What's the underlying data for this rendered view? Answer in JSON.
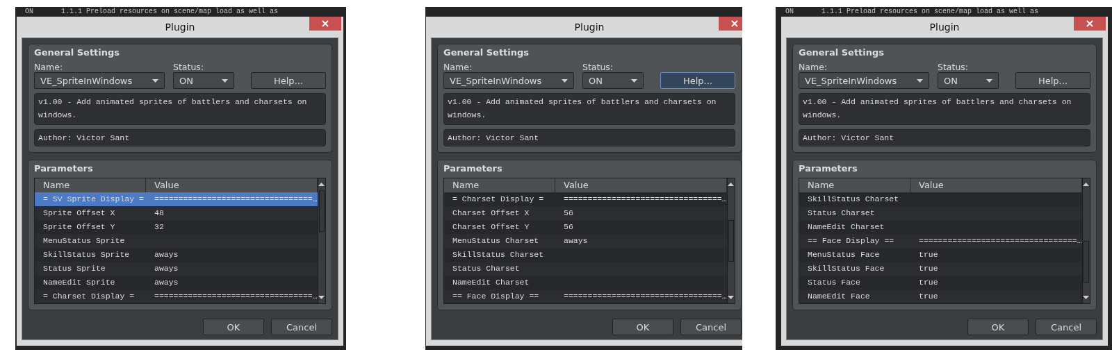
{
  "panels": [
    {
      "background_text": [
        "ON",
        "1.1.1 Preload resources on scene/map load as well as"
      ],
      "dialog": {
        "title": "Plugin",
        "general_settings": {
          "title": "General Settings",
          "name_label": "Name:",
          "name_value": "VE_SpriteInWindows",
          "status_label": "Status:",
          "status_value": "ON",
          "help_button": {
            "label": "Help...",
            "focused": false
          },
          "description": "v1.00 - Add animated sprites of battlers and charsets on windows.",
          "author": "Author: Victor Sant"
        },
        "parameters": {
          "title": "Parameters",
          "columns": [
            "Name",
            "Value"
          ],
          "rows": [
            {
              "name": "= SV Sprite Display =",
              "value": "=================================…",
              "selected": true
            },
            {
              "name": "Sprite Offset X",
              "value": "48",
              "selected": false
            },
            {
              "name": "Sprite Offset Y",
              "value": "32",
              "selected": false
            },
            {
              "name": "MenuStatus Sprite",
              "selected": false
            },
            {
              "name": "SkillStatus Sprite",
              "value": "aways",
              "selected": false
            },
            {
              "name": "Status Sprite",
              "value": "aways",
              "selected": false
            },
            {
              "name": "NameEdit Sprite",
              "value": "aways",
              "selected": false
            },
            {
              "name": "= Charset Display =",
              "value": "=================================…",
              "selected": false
            }
          ]
        },
        "buttons": [
          "OK",
          "Cancel"
        ]
      }
    },
    {
      "dialog": {
        "title": "Plugin",
        "general_settings": {
          "title": "General Settings",
          "name_label": "Name:",
          "name_value": "VE_SpriteInWindows",
          "status_label": "Status:",
          "status_value": "ON",
          "help_button": {
            "label": "Help...",
            "focused": true
          },
          "description": "v1.00 - Add animated sprites of battlers and charsets on windows.",
          "author": "Author: Victor Sant"
        },
        "parameters": {
          "title": "Parameters",
          "columns": [
            "Name",
            "Value"
          ],
          "rows": [
            {
              "name": "= Charset Display =",
              "value": "=================================…",
              "selected": false
            },
            {
              "name": "Charset Offset X",
              "value": "56",
              "selected": false
            },
            {
              "name": "Charset Offset Y",
              "value": "56",
              "selected": false
            },
            {
              "name": "MenuStatus Charset",
              "value": "aways",
              "selected": false
            },
            {
              "name": "SkillStatus Charset",
              "selected": false
            },
            {
              "name": "Status Charset",
              "selected": false
            },
            {
              "name": "NameEdit Charset",
              "selected": false
            },
            {
              "name": "== Face Display ==",
              "value": "=================================…",
              "selected": false
            }
          ]
        },
        "buttons": [
          "OK",
          "Cancel"
        ]
      }
    },
    {
      "background_text": [
        "ON",
        "1.1.1 Preload resources on scene/map load as well as"
      ],
      "dialog": {
        "title": "Plugin",
        "general_settings": {
          "title": "General Settings",
          "name_label": "Name:",
          "name_value": "VE_SpriteInWindows",
          "status_label": "Status:",
          "status_value": "ON",
          "help_button": {
            "label": "Help...",
            "focused": false
          },
          "description": "v1.00 - Add animated sprites of battlers and charsets on windows.",
          "author": "Author: Victor Sant"
        },
        "parameters": {
          "title": "Parameters",
          "columns": [
            "Name",
            "Value"
          ],
          "rows": [
            {
              "name": "SkillStatus Charset",
              "selected": false
            },
            {
              "name": "Status Charset",
              "selected": false
            },
            {
              "name": "NameEdit Charset",
              "selected": false
            },
            {
              "name": "== Face Display ==",
              "value": "=================================…",
              "selected": false
            },
            {
              "name": "MenuStatus Face",
              "value": "true",
              "selected": false
            },
            {
              "name": "SkillStatus Face",
              "value": "true",
              "selected": false
            },
            {
              "name": "Status Face",
              "value": "true",
              "selected": false
            },
            {
              "name": "NameEdit Face",
              "value": "true",
              "selected": false
            }
          ]
        },
        "buttons": [
          "OK",
          "Cancel"
        ]
      }
    }
  ]
}
